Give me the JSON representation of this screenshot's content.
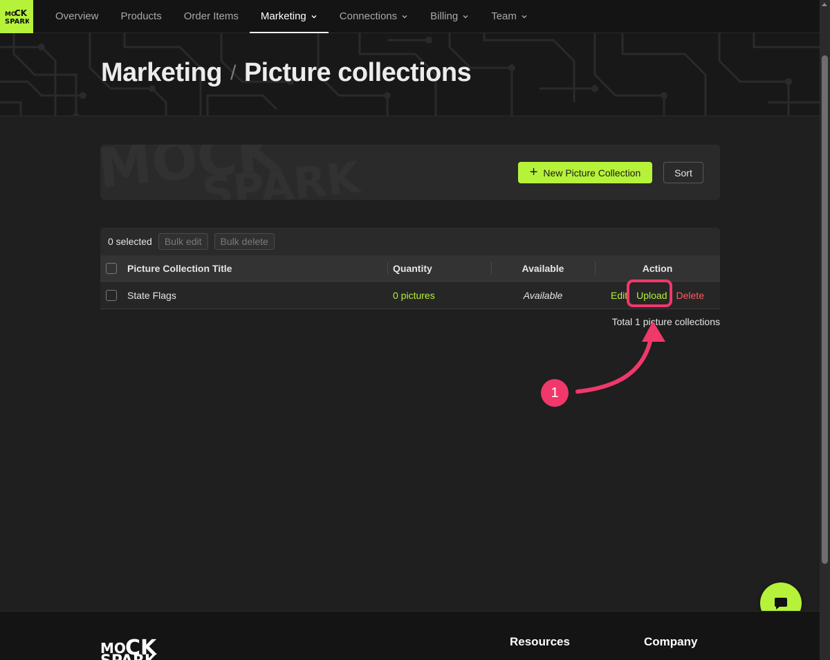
{
  "brand": {
    "logo_text": "MOCK SPARK",
    "accent_color": "#b6f23a"
  },
  "nav": {
    "items": [
      {
        "label": "Overview",
        "has_dropdown": false,
        "active": false
      },
      {
        "label": "Products",
        "has_dropdown": false,
        "active": false
      },
      {
        "label": "Order Items",
        "has_dropdown": false,
        "active": false
      },
      {
        "label": "Marketing",
        "has_dropdown": true,
        "active": true
      },
      {
        "label": "Connections",
        "has_dropdown": true,
        "active": false
      },
      {
        "label": "Billing",
        "has_dropdown": true,
        "active": false
      },
      {
        "label": "Team",
        "has_dropdown": true,
        "active": false
      }
    ]
  },
  "header": {
    "breadcrumb_parent": "Marketing",
    "breadcrumb_separator": "/",
    "title": "Picture collections"
  },
  "toolbar": {
    "new_button_label": "New Picture Collection",
    "sort_button_label": "Sort"
  },
  "table": {
    "selected_text": "0 selected",
    "bulk_edit_label": "Bulk edit",
    "bulk_delete_label": "Bulk delete",
    "columns": [
      "Picture Collection Title",
      "Quantity",
      "Available",
      "Action"
    ],
    "rows": [
      {
        "title": "State Flags",
        "quantity": "0 pictures",
        "available": "Available",
        "actions": {
          "edit": "Edit",
          "upload": "Upload",
          "delete": "Delete"
        }
      }
    ],
    "total_text": "Total 1 picture collections"
  },
  "annotation": {
    "step_number": "1",
    "highlight_color": "#f0386b"
  },
  "footer": {
    "headings": [
      "Resources",
      "Company"
    ]
  },
  "chat": {
    "icon": "chat-bubble-icon"
  }
}
